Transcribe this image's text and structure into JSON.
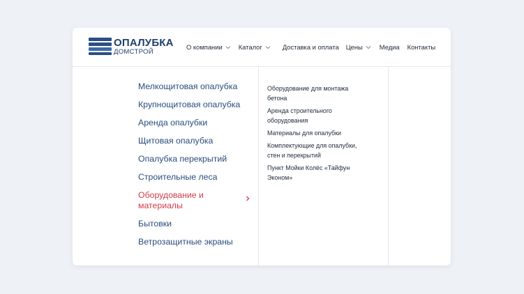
{
  "brand": {
    "title": "ОПАЛУБКА",
    "subtitle": "ДОМСТРОЙ",
    "color": "#1f3f6e"
  },
  "nav": [
    {
      "label": "О компании",
      "dropdown": true
    },
    {
      "label": "Каталог",
      "dropdown": true
    },
    {
      "label": "Доставка и оплата",
      "dropdown": false
    },
    {
      "label": "Цены",
      "dropdown": true
    },
    {
      "label": "Медиа",
      "dropdown": false
    },
    {
      "label": "Контакты",
      "dropdown": false
    }
  ],
  "menu": {
    "primary": [
      {
        "label": "Мелкощитовая опалубка"
      },
      {
        "label": "Крупнощитовая опалубка"
      },
      {
        "label": "Аренда опалубки"
      },
      {
        "label": "Щитовая опалубка"
      },
      {
        "label": "Опалубка перекрытий"
      },
      {
        "label": "Строительные леса"
      },
      {
        "label": "Оборудование и материалы",
        "active": true
      },
      {
        "label": "Бытовки"
      },
      {
        "label": "Ветрозащитные экраны"
      }
    ],
    "secondary": [
      {
        "label": "Оборудование для монтажа бетона"
      },
      {
        "label": "Аренда строительного оборудования"
      },
      {
        "label": "Материалы для опалубки"
      },
      {
        "label": "Комплектующие для опалубки, стен и перекрытий"
      },
      {
        "label": "Пункт Мойки Колёс «Тайфун Эконом»"
      }
    ]
  },
  "colors": {
    "link": "#274d7c",
    "active": "#d23b48",
    "background": "#eef2f6"
  }
}
